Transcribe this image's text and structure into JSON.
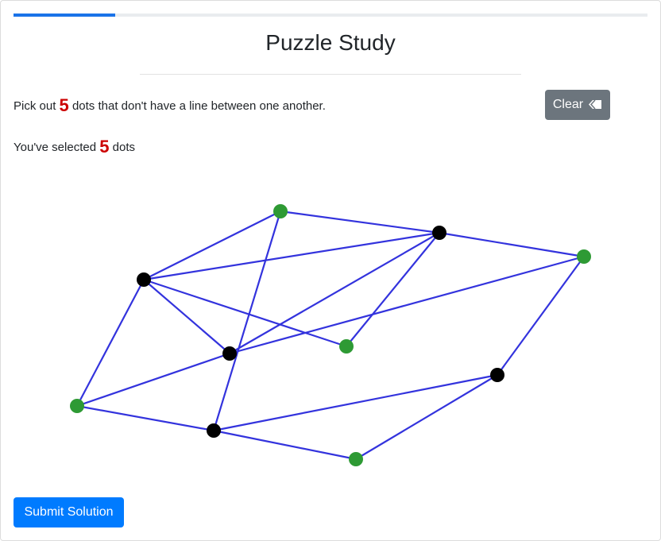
{
  "progress": {
    "fraction": 0.16,
    "color": "#1a73e8"
  },
  "page": {
    "title": "Puzzle Study"
  },
  "instruction": {
    "prefix": "Pick out",
    "count": "5",
    "suffix": "dots that don't have a line between one another."
  },
  "selection": {
    "prefix": "You've selected",
    "count": "5",
    "suffix": "dots"
  },
  "clear_button": {
    "label": "Clear",
    "icon": "eraser-icon"
  },
  "submit_button": {
    "label": "Submit Solution"
  },
  "colors": {
    "edge": "#3333dd",
    "selected_dot": "#2e9a34",
    "unselected_dot": "#000000",
    "accent_red": "#cc0000",
    "primary": "#007bff",
    "secondary": "#6c757d"
  },
  "graph": {
    "nodes": [
      {
        "id": 0,
        "selected": true
      },
      {
        "id": 1,
        "selected": false
      },
      {
        "id": 2,
        "selected": false
      },
      {
        "id": 3,
        "selected": true
      },
      {
        "id": 4,
        "selected": false
      },
      {
        "id": 5,
        "selected": true
      },
      {
        "id": 6,
        "selected": false
      },
      {
        "id": 7,
        "selected": true
      },
      {
        "id": 8,
        "selected": false
      },
      {
        "id": 9,
        "selected": true
      }
    ],
    "edges": [
      [
        0,
        1
      ],
      [
        0,
        2
      ],
      [
        0,
        4
      ],
      [
        1,
        4
      ],
      [
        1,
        5
      ],
      [
        1,
        8
      ],
      [
        1,
        9
      ],
      [
        2,
        3
      ],
      [
        2,
        6
      ],
      [
        3,
        6
      ],
      [
        4,
        8
      ],
      [
        5,
        8
      ],
      [
        5,
        2
      ],
      [
        6,
        7
      ],
      [
        7,
        8
      ],
      [
        7,
        4
      ],
      [
        8,
        9
      ]
    ]
  }
}
